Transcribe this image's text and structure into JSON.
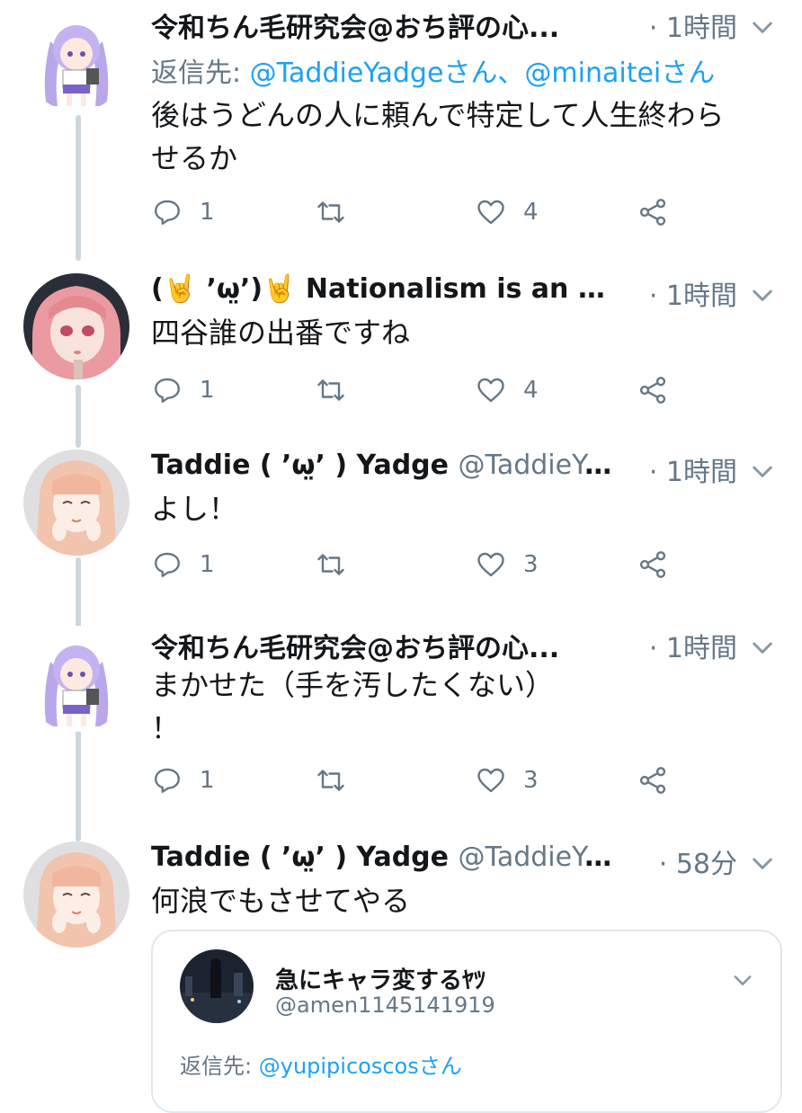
{
  "tweets": [
    {
      "name": "令和ちん毛研究会@おち評の心...",
      "handle": "",
      "time": "· 1時間",
      "reply_label": "返信先:",
      "reply_to": "@TaddieYadgeさん、@minaiteiさん",
      "text": "後はうどんの人に頼んで特定して人生終わら\nせるか",
      "replies": "1",
      "retweets": "",
      "likes": "4",
      "avatar": "anime-girl-purple-hair-avatar"
    },
    {
      "name": "(🤘 ’ω̤̮’)🤘 Nationalism is an sop...",
      "handle": "",
      "time": "· 1時間",
      "text": "四谷誰の出番ですね",
      "replies": "1",
      "retweets": "",
      "likes": "4",
      "avatar": "doll-pink-hair-avatar"
    },
    {
      "name": "Taddie ( ’ω̤̮’ ) Yadge",
      "handle": "@TaddieYad...",
      "time": "· 1時間",
      "text": "よし！",
      "replies": "1",
      "retweets": "",
      "likes": "3",
      "avatar": "illustrated-girl-peach-hair-avatar"
    },
    {
      "name": "令和ちん毛研究会@おち評の心...",
      "handle": "",
      "time": "· 1時間",
      "text": "まかせた（手を汚したくない）\n！",
      "replies": "1",
      "retweets": "",
      "likes": "3",
      "avatar": "anime-girl-purple-hair-avatar"
    },
    {
      "name": "Taddie ( ’ω̤̮’ ) Yadge",
      "handle": "@TaddieYadge",
      "time": "· 58分",
      "text": "何浪でもさせてやる",
      "avatar": "illustrated-girl-peach-hair-avatar"
    }
  ],
  "quote": {
    "name": "急にキャラ変するﾔﾂ",
    "handle": "@amen1145141919",
    "reply_label": "返信先:",
    "reply_to": "@yupipicoscosさん",
    "avatar": "night-city-photo-avatar"
  },
  "icons": {
    "reply": "speech-bubble-icon",
    "retweet": "retweet-arrows-icon",
    "like": "heart-outline-icon",
    "share": "share-nodes-icon",
    "menu": "chevron-down-icon"
  },
  "colors": {
    "link": "#1da1f2",
    "secondary_text": "#657786",
    "thread_line": "#cdd6dd",
    "border": "#e1e8ed"
  }
}
